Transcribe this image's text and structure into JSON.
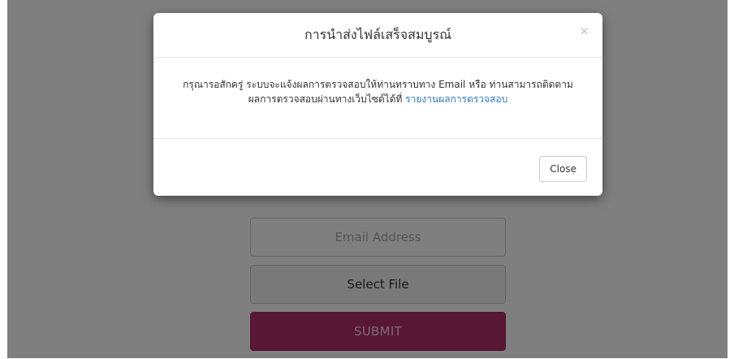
{
  "form": {
    "email_placeholder": "Email Address",
    "select_file_label": "Select File",
    "submit_label": "SUBMIT"
  },
  "modal": {
    "title": "การนำส่งไฟล์เสร็จสมบูรณ์",
    "close_icon_glyph": "×",
    "body_line1": "กรุณารอสักครู่ ระบบจะแจ้งผลการตรวจสอบให้ท่านทราบทาง Email หรือ ท่านสามารถติดตาม",
    "body_line2_prefix": "ผลการตรวจสอบผ่านทางเว็บไซต์ได้ที่ ",
    "body_link": "รายงานผลการตรวจสอบ",
    "close_button_label": "Close"
  },
  "colors": {
    "submit_background": "#b0306a",
    "link": "#337ab7",
    "backdrop": "rgba(0,0,0,0.5)"
  }
}
